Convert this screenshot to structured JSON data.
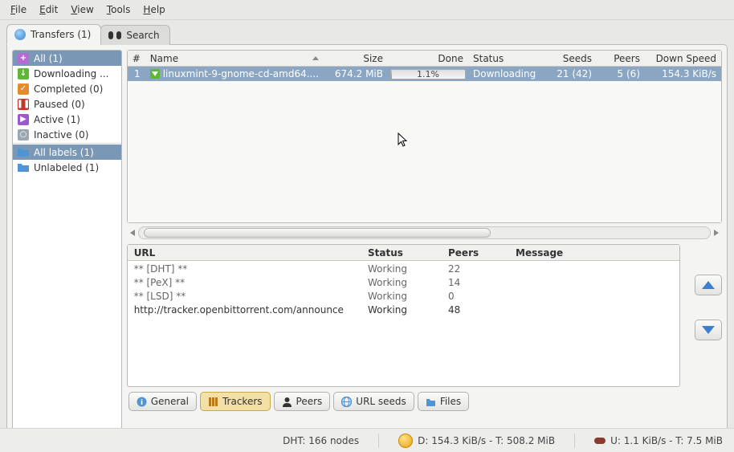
{
  "menubar": [
    "File",
    "Edit",
    "View",
    "Tools",
    "Help"
  ],
  "tabs": {
    "transfers": "Transfers (1)",
    "search": "Search"
  },
  "sidebar": {
    "groups": [
      [
        {
          "color": "#b66bd3",
          "label": "All (1)",
          "sym": "+",
          "selected": true
        },
        {
          "color": "#5fb736",
          "label": "Downloading ...",
          "sym": "↓"
        },
        {
          "color": "#e68a2e",
          "label": "Completed (0)",
          "sym": "✓"
        },
        {
          "color": "#c0392b",
          "label": "Paused (0)",
          "sym": "❚❚"
        },
        {
          "color": "#9a59d0",
          "label": "Active (1)",
          "sym": "▶"
        },
        {
          "color": "#9aa7b1",
          "label": "Inactive (0)",
          "sym": "○"
        }
      ],
      [
        {
          "color": "#4f94d4",
          "label": "All labels (1)",
          "sym": "",
          "selected": true,
          "folder": true
        },
        {
          "color": "#4f94d4",
          "label": "Unlabeled (1)",
          "sym": "",
          "folder": true
        }
      ]
    ]
  },
  "torrentHeaders": {
    "num": "#",
    "name": "Name",
    "size": "Size",
    "done": "Done",
    "status": "Status",
    "seeds": "Seeds",
    "peers": "Peers",
    "down": "Down Speed"
  },
  "torrent": {
    "num": "1",
    "name": "linuxmint-9-gnome-cd-amd64....",
    "size": "674.2 MiB",
    "donePct": "1.1%",
    "doneFill": 1.1,
    "status": "Downloading",
    "seeds": "21 (42)",
    "peers": "5 (6)",
    "down": "154.3 KiB/s"
  },
  "trackers": {
    "headers": {
      "url": "URL",
      "status": "Status",
      "peers": "Peers",
      "message": "Message"
    },
    "rows": [
      {
        "url": "** [DHT] **",
        "status": "Working",
        "peers": "22",
        "strong": false
      },
      {
        "url": "** [PeX] **",
        "status": "Working",
        "peers": "14",
        "strong": false
      },
      {
        "url": "** [LSD] **",
        "status": "Working",
        "peers": "0",
        "strong": false
      },
      {
        "url": "http://tracker.openbittorrent.com/announce",
        "status": "Working",
        "peers": "48",
        "strong": true
      }
    ]
  },
  "detailTabs": {
    "general": "General",
    "trackers": "Trackers",
    "peers": "Peers",
    "urlseeds": "URL seeds",
    "files": "Files"
  },
  "statusbar": {
    "dht": "DHT: 166 nodes",
    "down": "D: 154.3 KiB/s - T: 508.2 MiB",
    "up": "U: 1.1 KiB/s - T: 7.5 MiB"
  }
}
